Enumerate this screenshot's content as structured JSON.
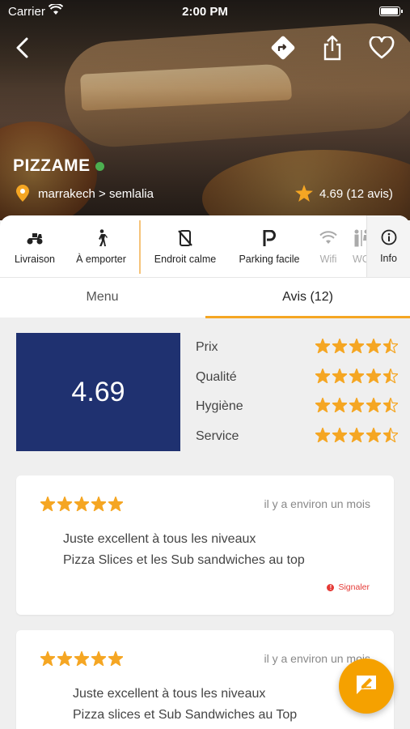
{
  "status_bar": {
    "carrier": "Carrier",
    "time": "2:00 PM"
  },
  "header": {
    "restaurant_name": "PIZZAME",
    "location": "marrakech > semlalia",
    "rating": "4.69 (12 avis)",
    "actions": {
      "back": "back-icon",
      "directions": "directions-icon",
      "share": "share-icon",
      "favorite": "heart-icon"
    }
  },
  "features": {
    "items": [
      {
        "label": "Livraison",
        "icon": "scooter-icon"
      },
      {
        "label": "À emporter",
        "icon": "walking-icon"
      },
      {
        "label": "Endroit calme",
        "icon": "no-phone-icon"
      },
      {
        "label": "Parking facile",
        "icon": "parking-icon"
      },
      {
        "label": "Wifi",
        "icon": "wifi-icon"
      },
      {
        "label": "WC",
        "icon": "restroom-icon"
      }
    ],
    "info_label": "Info"
  },
  "tabs": [
    {
      "label": "Menu",
      "active": false
    },
    {
      "label": "Avis (12)",
      "active": true
    }
  ],
  "summary": {
    "score": "4.69",
    "criteria": [
      {
        "label": "Prix",
        "rating": 4.5
      },
      {
        "label": "Qualité",
        "rating": 4.5
      },
      {
        "label": "Hygiène",
        "rating": 4.5
      },
      {
        "label": "Service",
        "rating": 4.5
      }
    ]
  },
  "reviews": [
    {
      "rating": 5,
      "date": "il y a environ un mois",
      "line1": "Juste excellent à tous les niveaux",
      "line2": "Pizza Slices et les Sub sandwiches au top",
      "report_label": "Signaler"
    },
    {
      "rating": 5,
      "date": "il y a environ un mois",
      "line1": "Juste excellent à tous les niveaux",
      "line2": "Pizza slices et Sub Sandwiches au Top"
    }
  ],
  "colors": {
    "accent": "#f5a623",
    "score_bg": "#1f3170",
    "online": "#4caf50",
    "report": "#e53935",
    "star": "#f5a623"
  }
}
